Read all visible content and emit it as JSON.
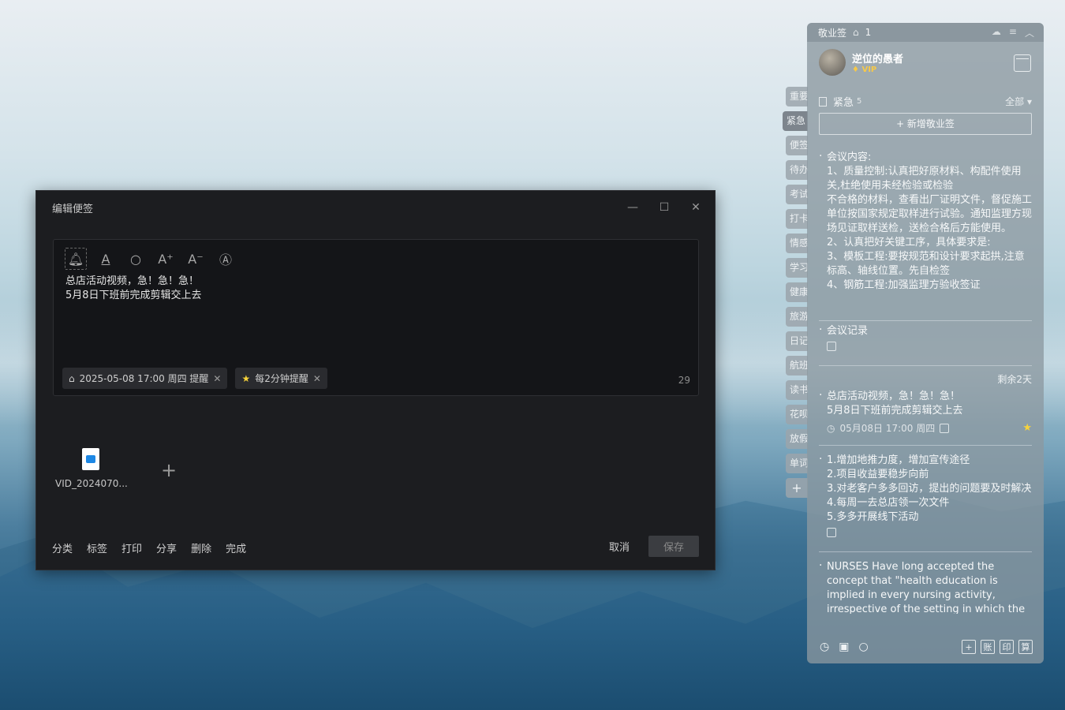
{
  "editor": {
    "title": "编辑便签",
    "content_lines": [
      "总店活动视频，急！急！急！",
      "5月8日下班前完成剪辑交上去"
    ],
    "tags": [
      {
        "label": "2025-05-08 17:00 周四 提醒",
        "icon": "bell-icon"
      },
      {
        "label": "每2分钟提醒",
        "icon": "star-icon"
      }
    ],
    "char_count": "29",
    "attachment_name": "VID_2024070...",
    "bottom_actions": [
      "分类",
      "标签",
      "打印",
      "分享",
      "删除",
      "完成"
    ],
    "cancel_label": "取消",
    "save_label": "保存"
  },
  "side_tabs": [
    "重要",
    "紧急",
    "便签",
    "待办",
    "考试",
    "打卡",
    "情感",
    "学习",
    "健康",
    "旅游",
    "日记",
    "航班",
    "读书",
    "花呗",
    "放假",
    "单词"
  ],
  "panel": {
    "app_name": "敬业签",
    "alert_count": "1",
    "user_name": "逆位的愚者",
    "vip_label": "VIP",
    "category": "紧急",
    "category_count": "5",
    "filter_label": "全部",
    "new_button": "+ 新增敬业签",
    "notes": [
      {
        "lines": [
          "会议内容:",
          "1、质量控制:认真把好原材料、构配件使用关,杜绝使用未经检验或检验",
          "不合格的材料，查看出厂证明文件，督促施工单位按国家规定取样进行试验。通知监理方现场见证取样送检，送检合格后方能使用。",
          "2、认真把好关键工序，具体要求是:",
          "3、模板工程:要按规范和设计要求起拱,注意标高、轴线位置。先自检签",
          "4、钢筋工程:加强监理方验收签证"
        ]
      },
      {
        "lines": [
          "会议记录"
        ]
      },
      {
        "remain": "剩余2天",
        "lines": [
          "总店活动视频，急！急！急！",
          "5月8日下班前完成剪辑交上去"
        ],
        "time": "05月08日 17:00 周四"
      },
      {
        "lines": [
          "1.增加地推力度，增加宣传途径",
          "2.项目收益要稳步向前",
          "3.对老客户多多回访，提出的问题要及时解决",
          "4.每周一去总店领一次文件",
          "5.多多开展线下活动"
        ]
      },
      {
        "lines": [
          "NURSES Have long accepted the concept that \"health education is implied in every nursing activity, irrespective of the setting in which the"
        ]
      }
    ],
    "bottom_sq": [
      "+",
      "账",
      "印",
      "算"
    ]
  }
}
